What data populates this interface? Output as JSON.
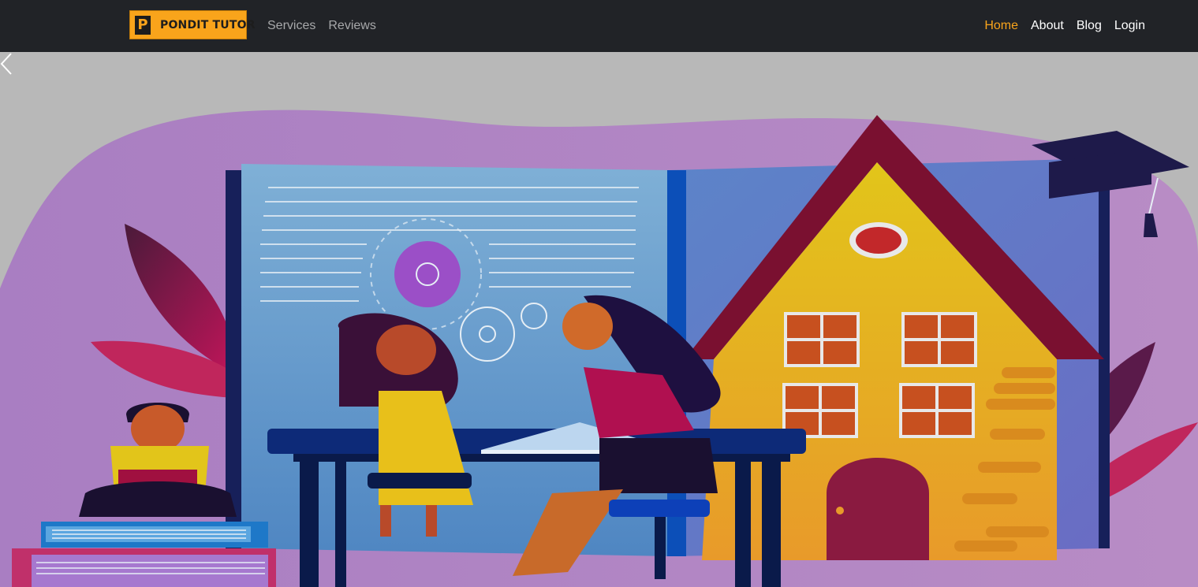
{
  "brand": {
    "mark": "P",
    "name": "PONDIT TUTOR"
  },
  "nav": {
    "left": [
      {
        "label": "Services"
      },
      {
        "label": "Reviews"
      }
    ],
    "right": [
      {
        "label": "Home",
        "active": true
      },
      {
        "label": "About"
      },
      {
        "label": "Blog"
      },
      {
        "label": "Login"
      }
    ]
  },
  "carousel": {
    "prev_icon": "chevron-left-icon"
  },
  "colors": {
    "navbar": "#212327",
    "accent": "#f9a41b",
    "hero_bg": "#b8b8b8"
  }
}
